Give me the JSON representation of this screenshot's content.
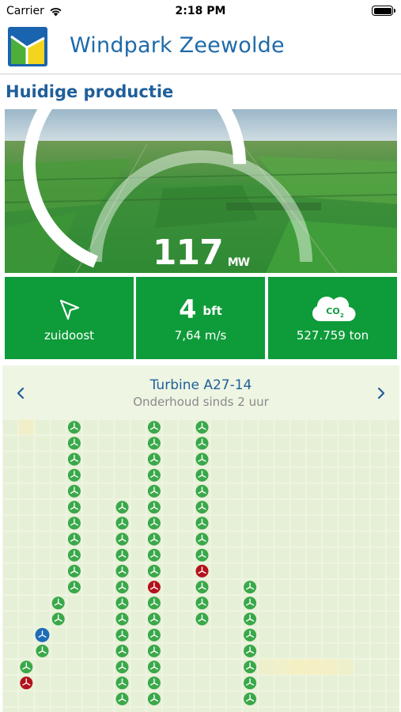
{
  "status_bar": {
    "carrier": "Carrier",
    "time": "2:18 PM"
  },
  "header": {
    "title": "Windpark Zeewolde"
  },
  "section": {
    "title": "Huidige productie"
  },
  "gauge": {
    "value": "117",
    "unit": "MW",
    "fraction": 0.62
  },
  "stats": {
    "wind_direction": "zuidoost",
    "wind_force": "4",
    "wind_force_unit": "bft",
    "wind_speed": "7,64 m/s",
    "co2_label": "CO",
    "co2_sub": "2",
    "co2_saved": "527.759 ton"
  },
  "turbine_panel": {
    "name": "Turbine A27-14",
    "status": "Onderhoud sinds 2 uur"
  },
  "colors": {
    "primary_blue": "#1f6aa8",
    "tile_green": "#0e9b3a",
    "turbine_ok": "#3aa84a",
    "turbine_fault": "#b3121c",
    "turbine_selected": "#1e6cb8",
    "panel_bg": "#eef5e3",
    "highlight": "#f6efc2"
  },
  "turbines": [
    {
      "col": 4,
      "row": 0,
      "state": "ok"
    },
    {
      "col": 4,
      "row": 1,
      "state": "ok"
    },
    {
      "col": 4,
      "row": 2,
      "state": "ok"
    },
    {
      "col": 4,
      "row": 3,
      "state": "ok"
    },
    {
      "col": 4,
      "row": 4,
      "state": "ok"
    },
    {
      "col": 4,
      "row": 5,
      "state": "ok"
    },
    {
      "col": 4,
      "row": 6,
      "state": "ok"
    },
    {
      "col": 4,
      "row": 7,
      "state": "ok"
    },
    {
      "col": 4,
      "row": 8,
      "state": "ok"
    },
    {
      "col": 4,
      "row": 9,
      "state": "ok"
    },
    {
      "col": 4,
      "row": 10,
      "state": "ok"
    },
    {
      "col": 3,
      "row": 11,
      "state": "ok"
    },
    {
      "col": 3,
      "row": 12,
      "state": "ok"
    },
    {
      "col": 2,
      "row": 13,
      "state": "selected"
    },
    {
      "col": 2,
      "row": 14,
      "state": "ok"
    },
    {
      "col": 1,
      "row": 15,
      "state": "ok"
    },
    {
      "col": 1,
      "row": 16,
      "state": "fault"
    },
    {
      "col": 7,
      "row": 5,
      "state": "ok"
    },
    {
      "col": 7,
      "row": 6,
      "state": "ok"
    },
    {
      "col": 7,
      "row": 7,
      "state": "ok"
    },
    {
      "col": 7,
      "row": 8,
      "state": "ok"
    },
    {
      "col": 7,
      "row": 9,
      "state": "ok"
    },
    {
      "col": 7,
      "row": 10,
      "state": "ok"
    },
    {
      "col": 7,
      "row": 11,
      "state": "ok"
    },
    {
      "col": 7,
      "row": 12,
      "state": "ok"
    },
    {
      "col": 7,
      "row": 13,
      "state": "ok"
    },
    {
      "col": 7,
      "row": 14,
      "state": "ok"
    },
    {
      "col": 7,
      "row": 15,
      "state": "ok"
    },
    {
      "col": 7,
      "row": 16,
      "state": "ok"
    },
    {
      "col": 7,
      "row": 17,
      "state": "ok"
    },
    {
      "col": 9,
      "row": 0,
      "state": "ok"
    },
    {
      "col": 9,
      "row": 1,
      "state": "ok"
    },
    {
      "col": 9,
      "row": 2,
      "state": "ok"
    },
    {
      "col": 9,
      "row": 3,
      "state": "ok"
    },
    {
      "col": 9,
      "row": 4,
      "state": "ok"
    },
    {
      "col": 9,
      "row": 5,
      "state": "ok"
    },
    {
      "col": 9,
      "row": 6,
      "state": "ok"
    },
    {
      "col": 9,
      "row": 7,
      "state": "ok"
    },
    {
      "col": 9,
      "row": 8,
      "state": "ok"
    },
    {
      "col": 9,
      "row": 9,
      "state": "ok"
    },
    {
      "col": 9,
      "row": 10,
      "state": "fault"
    },
    {
      "col": 9,
      "row": 11,
      "state": "ok"
    },
    {
      "col": 9,
      "row": 12,
      "state": "ok"
    },
    {
      "col": 9,
      "row": 13,
      "state": "ok"
    },
    {
      "col": 9,
      "row": 14,
      "state": "ok"
    },
    {
      "col": 9,
      "row": 15,
      "state": "ok"
    },
    {
      "col": 9,
      "row": 16,
      "state": "ok"
    },
    {
      "col": 9,
      "row": 17,
      "state": "ok"
    },
    {
      "col": 12,
      "row": 0,
      "state": "ok"
    },
    {
      "col": 12,
      "row": 1,
      "state": "ok"
    },
    {
      "col": 12,
      "row": 2,
      "state": "ok"
    },
    {
      "col": 12,
      "row": 3,
      "state": "ok"
    },
    {
      "col": 12,
      "row": 4,
      "state": "ok"
    },
    {
      "col": 12,
      "row": 5,
      "state": "ok"
    },
    {
      "col": 12,
      "row": 6,
      "state": "ok"
    },
    {
      "col": 12,
      "row": 7,
      "state": "ok"
    },
    {
      "col": 12,
      "row": 8,
      "state": "ok"
    },
    {
      "col": 12,
      "row": 9,
      "state": "fault"
    },
    {
      "col": 12,
      "row": 10,
      "state": "ok"
    },
    {
      "col": 12,
      "row": 11,
      "state": "ok"
    },
    {
      "col": 12,
      "row": 12,
      "state": "ok"
    },
    {
      "col": 15,
      "row": 10,
      "state": "ok"
    },
    {
      "col": 15,
      "row": 11,
      "state": "ok"
    },
    {
      "col": 15,
      "row": 12,
      "state": "ok"
    },
    {
      "col": 15,
      "row": 13,
      "state": "ok"
    },
    {
      "col": 15,
      "row": 14,
      "state": "ok"
    },
    {
      "col": 15,
      "row": 15,
      "state": "ok"
    },
    {
      "col": 15,
      "row": 16,
      "state": "ok"
    },
    {
      "col": 15,
      "row": 17,
      "state": "ok"
    }
  ],
  "highlight_cells": [
    {
      "col": 1,
      "row": 0,
      "strength": 0.6
    },
    {
      "col": 16,
      "row": 15,
      "strength": 0.5
    },
    {
      "col": 17,
      "row": 15,
      "strength": 0.7
    },
    {
      "col": 18,
      "row": 15,
      "strength": 0.9
    },
    {
      "col": 19,
      "row": 15,
      "strength": 0.9
    },
    {
      "col": 20,
      "row": 15,
      "strength": 0.8
    },
    {
      "col": 21,
      "row": 15,
      "strength": 0.5
    }
  ]
}
